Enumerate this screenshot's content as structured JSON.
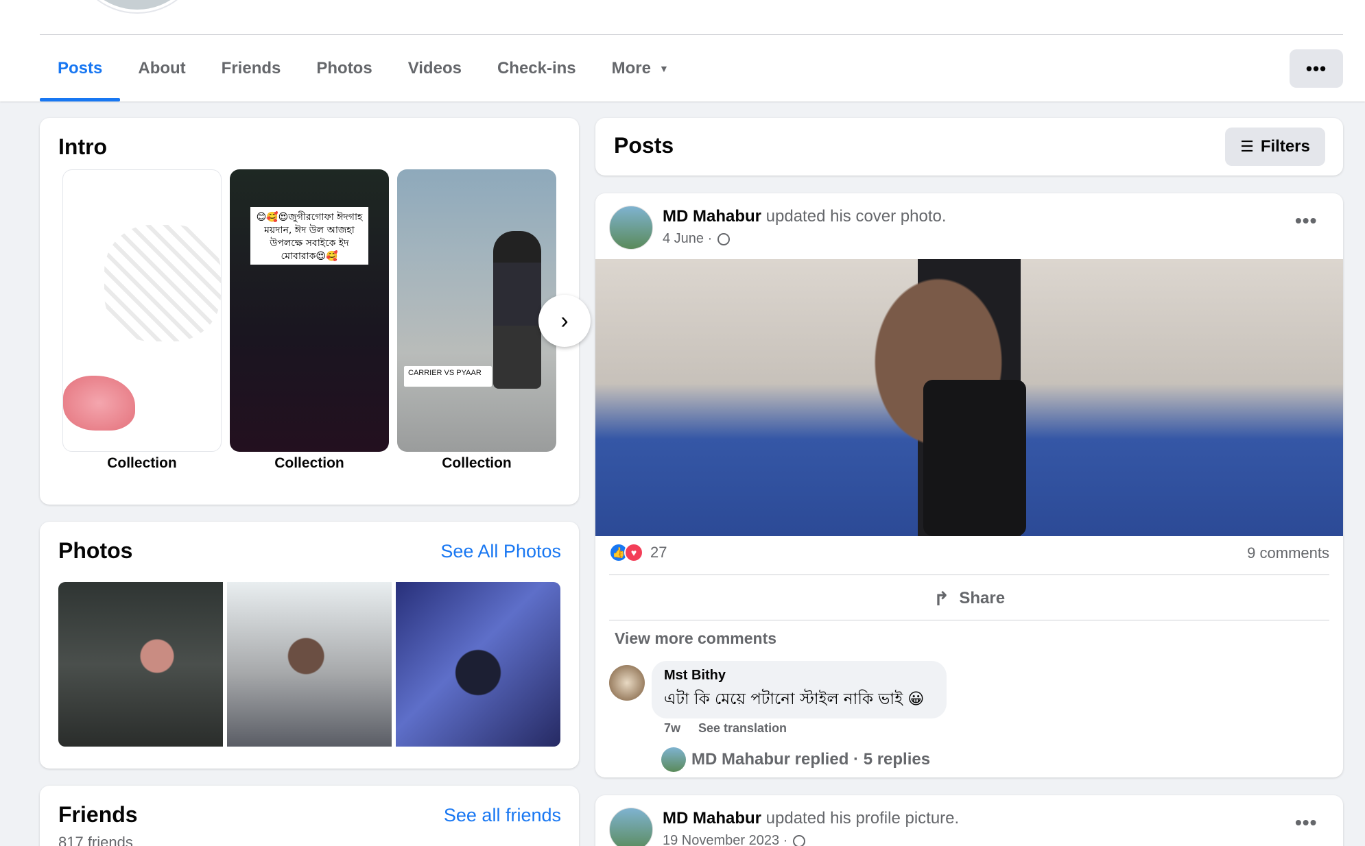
{
  "tabs": [
    {
      "label": "Posts"
    },
    {
      "label": "About"
    },
    {
      "label": "Friends"
    },
    {
      "label": "Photos"
    },
    {
      "label": "Videos"
    },
    {
      "label": "Check-ins"
    },
    {
      "label": "More"
    }
  ],
  "more_options_icon": "horizontal-dots-icon",
  "intro": {
    "title": "Intro",
    "collections": [
      {
        "label": "Collection"
      },
      {
        "label": "Collection",
        "note": "😊🥰😍জুগীরগোফা ঈদগাহ ময়দান, ঈদ উল আজহা উপলক্ষে সবাইকে ইদ মোবারাক😍🥰"
      },
      {
        "label": "Collection",
        "tag": "CARRIER VS PYAAR"
      }
    ]
  },
  "photos": {
    "title": "Photos",
    "see_all": "See All Photos"
  },
  "friends": {
    "title": "Friends",
    "see_all": "See all friends",
    "count": "817 friends"
  },
  "posts_header": {
    "title": "Posts",
    "filters": "Filters"
  },
  "post1": {
    "author": "MD Mahabur",
    "action": " updated his cover photo.",
    "date": "4 June ·",
    "reaction_count": "27",
    "comments": "9 comments",
    "share": "Share",
    "view_more": "View more comments",
    "comment": {
      "name": "Mst Bithy",
      "text": "এটা কি মেয়ে পটানো স্টাইল নাকি ভাই 😀",
      "time": "7w",
      "translate": "See translation"
    },
    "replies": "MD Mahabur replied · 5 replies"
  },
  "post2": {
    "author": "MD Mahabur",
    "action": " updated his profile picture.",
    "date": "19 November 2023 ·"
  },
  "colors": {
    "accent": "#1877f2",
    "background": "#f0f2f5",
    "secondary_text": "#65676b"
  }
}
